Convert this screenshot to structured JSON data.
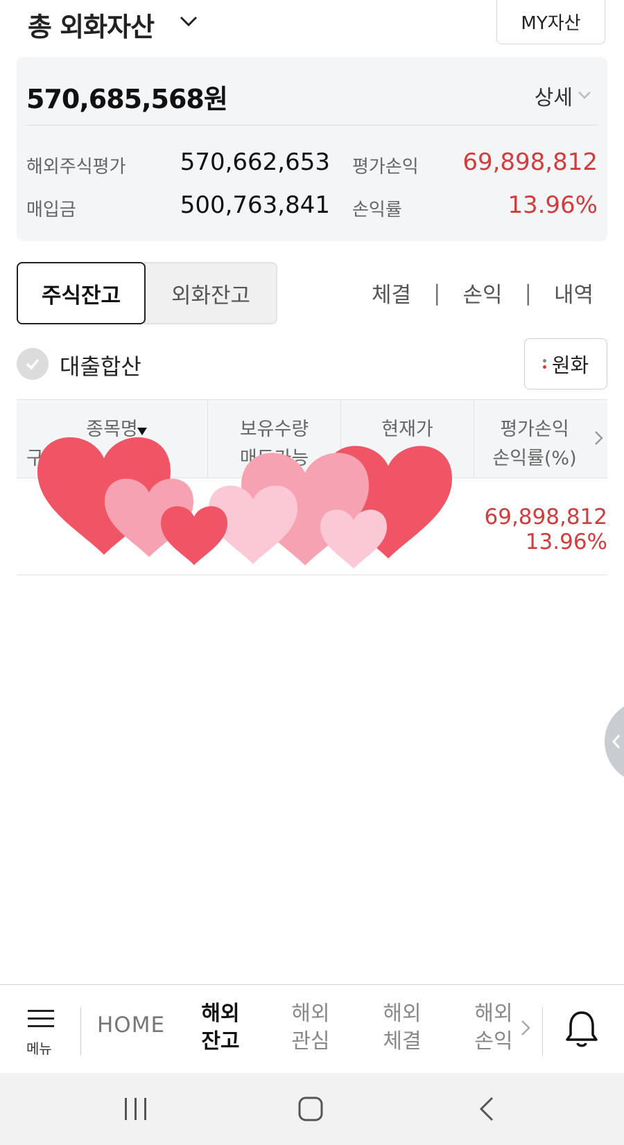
{
  "header": {
    "title": "총 외화자산",
    "my_asset_button": "MY자산"
  },
  "summary": {
    "total": "570,685,568원",
    "detail_label": "상세",
    "rows": [
      {
        "label": "해외주식평가",
        "value": "570,662,653",
        "label2": "평가손익",
        "value2": "69,898,812"
      },
      {
        "label": "매입금",
        "value": "500,763,841",
        "label2": "손익률",
        "value2": "13.96%"
      }
    ]
  },
  "tabs": {
    "active": "주식잔고",
    "inactive": "외화잔고"
  },
  "links": [
    "체결",
    "손익",
    "내역"
  ],
  "loan_toggle": {
    "label": "대출합산",
    "checked": true
  },
  "currency_button": "원화",
  "table": {
    "headers": [
      {
        "line1": "종목명",
        "line2": "구분"
      },
      {
        "line1": "보유수량",
        "line2": "매도가능"
      },
      {
        "line1": "현재가",
        "line2": ""
      },
      {
        "line1": "평가손익",
        "line2": "손익률(%)"
      }
    ],
    "rows": [
      {
        "profit": "69,898,812",
        "rate": "13.96%"
      }
    ]
  },
  "bottom_nav": {
    "menu_label": "메뉴",
    "home": "HOME",
    "items": [
      {
        "line1": "해외",
        "line2": "잔고",
        "active": true
      },
      {
        "line1": "해외",
        "line2": "관심",
        "active": false
      },
      {
        "line1": "해외",
        "line2": "체결",
        "active": false
      },
      {
        "line1": "해외",
        "line2": "손익",
        "active": false
      }
    ]
  },
  "colors": {
    "loss_profit_red": "#d23c3c",
    "summary_bg": "#f4f5f7",
    "text_dark": "#222222",
    "text_muted": "#666666"
  },
  "icons": [
    "chevron-down-icon",
    "check-icon",
    "more-dots-icon",
    "sort-down-icon",
    "chevron-right-icon",
    "hamburger-icon",
    "bell-icon",
    "recents-icon",
    "home-icon",
    "back-icon",
    "heart-sticker"
  ]
}
